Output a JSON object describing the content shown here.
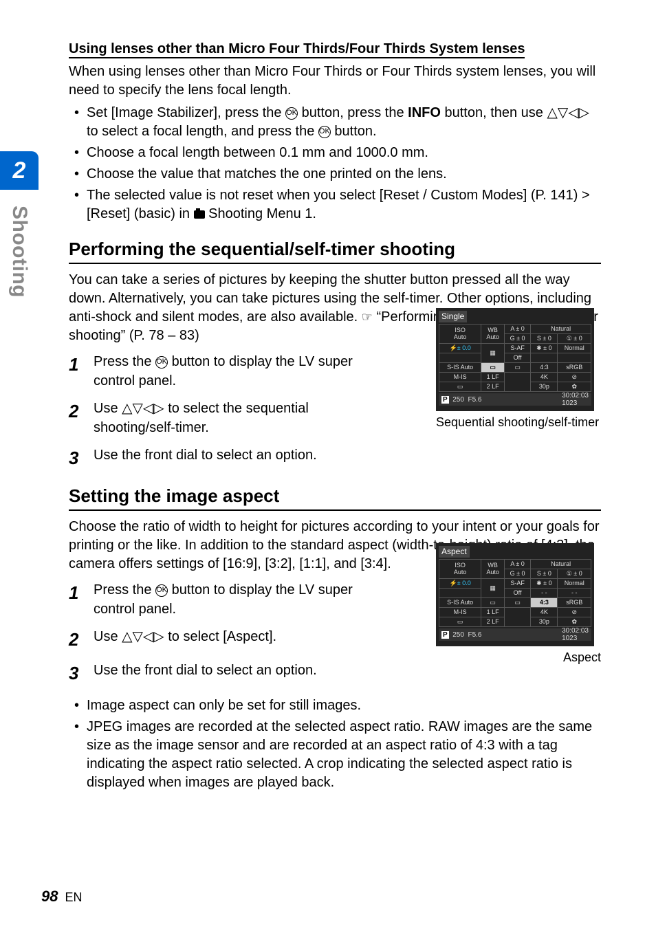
{
  "chapter": {
    "number": "2",
    "name": "Shooting"
  },
  "other_lenses": {
    "heading": "Using lenses other than Micro Four Thirds/Four Thirds System lenses",
    "intro": "When using lenses other than Micro Four Thirds or Four Thirds system lenses, you will need to specify the lens focal length.",
    "bullet1_pre": "Set [Image Stabilizer], press the ",
    "bullet1_mid1": " button, press the ",
    "bullet1_info": "INFO",
    "bullet1_mid2": " button, then use ",
    "bullet1_arrows": "△▽◁▷",
    "bullet1_mid3": " to select a focal length, and press the ",
    "bullet1_end": " button.",
    "bullet2": "Choose a focal length between 0.1 mm and 1000.0 mm.",
    "bullet3": "Choose the value that matches the one printed on the lens.",
    "bullet4": "The selected value is not reset when you select [Reset / Custom Modes] (P. 141) > [Reset] (basic) in ",
    "bullet4_end": " Shooting Menu 1."
  },
  "seq": {
    "heading": "Performing the sequential/self-timer shooting",
    "intro_pre": "You can take a series of pictures by keeping the shutter button pressed all the way down. Alternatively, you can take pictures using the self-timer. Other options, including anti-shock and silent modes, are also available. ",
    "intro_link": "“Performing the sequential/self-timer shooting” (P. 78 – 83)",
    "step1_pre": "Press the ",
    "step1_post": " button to display the LV super control panel.",
    "step2_pre": "Use ",
    "step2_arrows": "△▽◁▷",
    "step2_post": " to select the sequential shooting/self-timer.",
    "step3": "Use the front dial to select an option.",
    "caption": "Sequential shooting/self-timer"
  },
  "aspect": {
    "heading": "Setting the image aspect",
    "intro": "Choose the ratio of width to height for pictures according to your intent or your goals for printing or the like. In addition to the standard aspect (width-to-height) ratio of [4:3], the camera offers settings of [16:9], [3:2], [1:1], and [3:4].",
    "step1_pre": "Press the ",
    "step1_post": " button to display the LV super control panel.",
    "step2_pre": "Use ",
    "step2_arrows": "△▽◁▷",
    "step2_post": " to select [Aspect].",
    "step3": "Use the front dial to select an option.",
    "caption": "Aspect",
    "note1": "Image aspect can only be set for still images.",
    "note2": "JPEG images are recorded at the selected aspect ratio. RAW images are the same size as the image sensor and are recorded at an aspect ratio of 4:3 with a tag indicating the aspect ratio selected. A crop indicating the selected aspect ratio is displayed when images are played back."
  },
  "lv1": {
    "title": "Single",
    "iso": "ISO",
    "isov": "Auto",
    "wb": "WB",
    "wbv": "Auto",
    "a0": "A ± 0",
    "g0": "G ± 0",
    "nat": "Natural",
    "saf": "S-AF",
    "off": "Off",
    "sis": "S-IS Auto",
    "mis": "M-IS",
    "s0": "S ± 0",
    "d0": "① ± 0",
    "n0": "✱ ± 0",
    "norm": "Normal",
    "k4": "4K",
    "k30": "30p",
    "r43": "4:3",
    "srgb": "sRGB",
    "p": "P",
    "sh": "250",
    "ap": "F5.6",
    "rct": "30:02:03",
    "rcb": "1023",
    "flash": "⚡± 0.0",
    "one": "1",
    "two": "2",
    "lf": "LF"
  },
  "lv2": {
    "title": "Aspect",
    "iso": "ISO",
    "isov": "Auto",
    "wb": "WB",
    "wbv": "Auto",
    "a0": "A ± 0",
    "g0": "G ± 0",
    "nat": "Natural",
    "saf": "S-AF",
    "off": "Off",
    "sis": "S-IS Auto",
    "mis": "M-IS",
    "s0": "S ± 0",
    "d0": "① ± 0",
    "n0": "✱ ± 0",
    "norm": "Normal",
    "k4": "4K",
    "k30": "30p",
    "r43": "4:3",
    "srgb": "sRGB",
    "p": "P",
    "sh": "250",
    "ap": "F5.6",
    "rct": "30:02:03",
    "rcb": "1023",
    "flash": "⚡± 0.0",
    "dashes": "- -",
    "one": "1",
    "two": "2",
    "lf": "LF"
  },
  "footer": {
    "page": "98",
    "lang": "EN"
  },
  "glyph": {
    "ok": "OK"
  }
}
